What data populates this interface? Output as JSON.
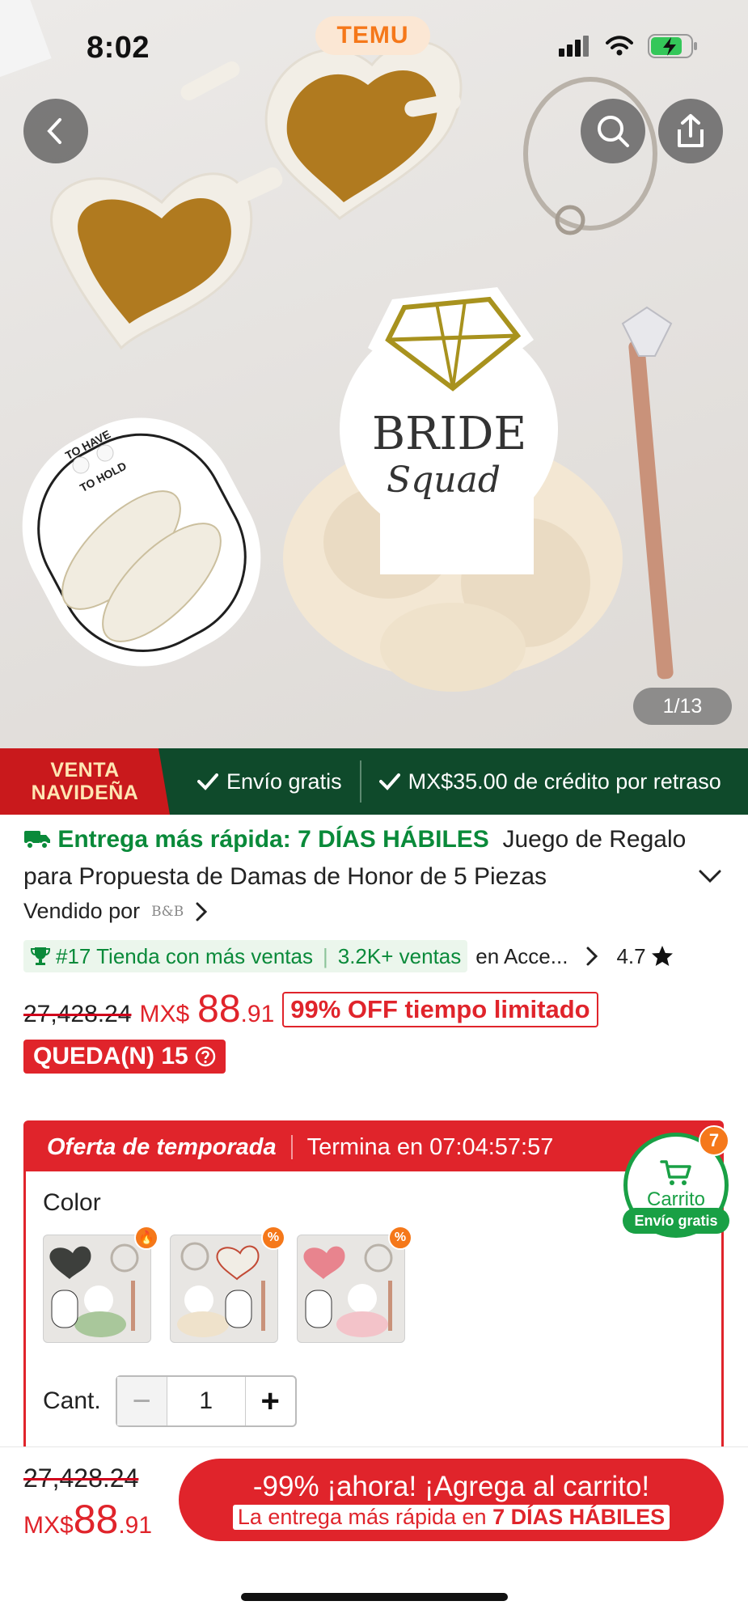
{
  "status_bar": {
    "time": "8:02",
    "brand": "TEMU"
  },
  "hero": {
    "image_counter": "1/13",
    "product_texts": [
      "BRIDE",
      "Squad",
      "TO HAVE",
      "TO HOLD"
    ]
  },
  "promo_strip": {
    "event_line1": "VENTA",
    "event_line2": "NAVIDEÑA",
    "free_shipping": "Envío gratis",
    "delay_credit": "MX$35.00 de crédito por retraso"
  },
  "product": {
    "delivery_label": "Entrega más rápida: 7 DÍAS HÁBILES",
    "title": "Juego de Regalo para Propuesta de Damas de Honor de 5 Piezas",
    "sold_by_label": "Vendido por",
    "seller_logo": "B&B",
    "rank_text": "#17 Tienda con más ventas",
    "sales_text": "3.2K+ ventas",
    "category_text": "en Acce...",
    "rating": "4.7",
    "original_price": "27,428.24",
    "currency": "MX$",
    "price_int": "88",
    "price_dec": ".91",
    "discount_text": "99% OFF tiempo limitado",
    "stock_text": "QUEDA(N) 15"
  },
  "offer": {
    "title": "Oferta de temporada",
    "countdown": "Termina en 07:04:57:57",
    "color_label": "Color",
    "quantity_label": "Cant.",
    "quantity_value": "1",
    "variant_badges": [
      "🔥",
      "%",
      "%"
    ]
  },
  "cart_fab": {
    "count": "7",
    "label": "Carrito",
    "free_shipping": "Envío gratis"
  },
  "bottom_bar": {
    "original_price": "27,428.24",
    "currency": "MX$",
    "price_int": "88",
    "price_dec": ".91",
    "cta_line1": "-99% ¡ahora! ¡Agrega al carrito!",
    "cta_line2_prefix": "La entrega más rápida en ",
    "cta_line2_bold": "7 DÍAS HÁBILES"
  },
  "colors": {
    "accent_red": "#e0242b",
    "temu_orange": "#f5781a",
    "green": "#0a8a3a",
    "promo_green": "#0f4a2b"
  }
}
